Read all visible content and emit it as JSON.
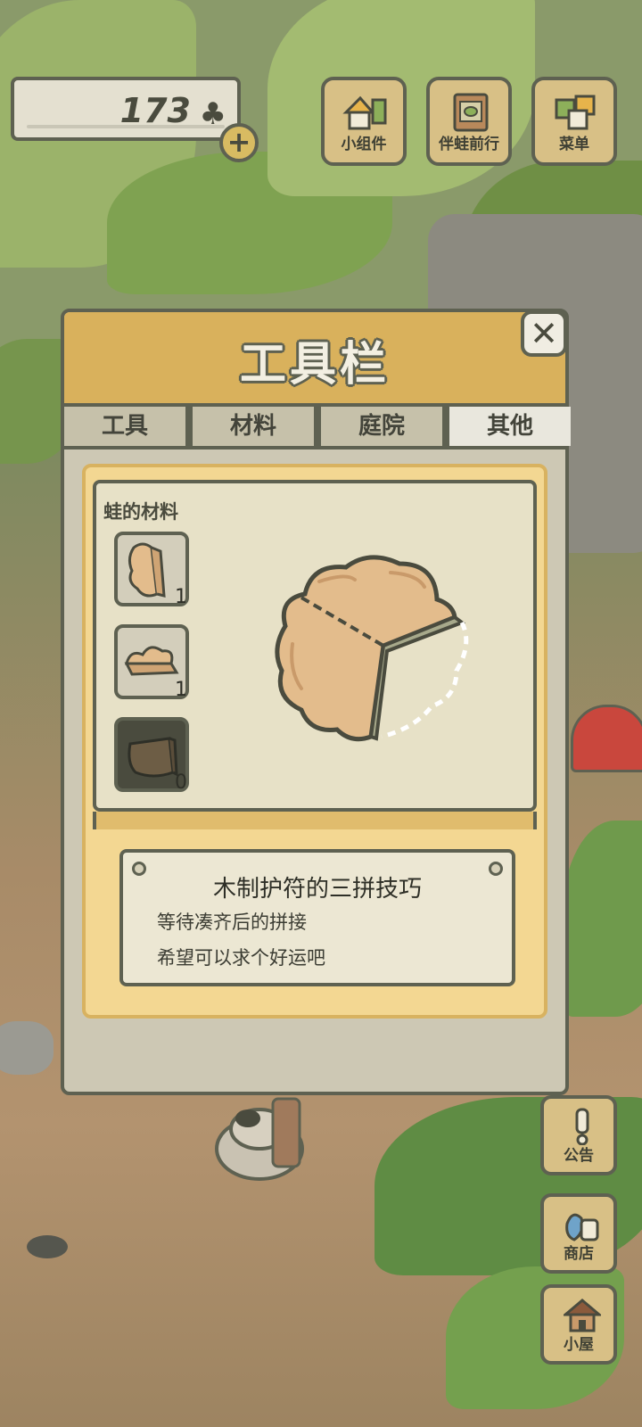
{
  "hud": {
    "clover_count": "173",
    "clover_symbol": "♣",
    "plus_symbol": "+"
  },
  "top_menu": [
    {
      "label": "小组件",
      "icon": "widget-icon"
    },
    {
      "label": "伴蛙前行",
      "icon": "journey-book-icon"
    },
    {
      "label": "菜单",
      "icon": "menu-cards-icon"
    }
  ],
  "side_menu": [
    {
      "label": "公告",
      "icon": "exclamation-icon"
    },
    {
      "label": "商店",
      "icon": "shop-bag-icon"
    },
    {
      "label": "小屋",
      "icon": "house-icon"
    }
  ],
  "panel": {
    "title": "工具栏",
    "close_symbol": "✕",
    "tabs": [
      {
        "label": "工具",
        "active": false
      },
      {
        "label": "材料",
        "active": false
      },
      {
        "label": "庭院",
        "active": false
      },
      {
        "label": "其他",
        "active": true
      }
    ],
    "section_label": "蛙的材料",
    "items": [
      {
        "name": "wood-charm-piece-a",
        "count": "1"
      },
      {
        "name": "wood-charm-piece-b",
        "count": "1"
      },
      {
        "name": "wood-charm-piece-c",
        "count": "0"
      }
    ],
    "description": {
      "title": "木制护符的三拼技巧",
      "line1": "等待凑齐后的拼接",
      "line2": "希望可以求个好运吧"
    }
  },
  "colors": {
    "outline": "#5e6151",
    "header_gold": "#d9b15c",
    "button_tan": "#d8c086"
  }
}
